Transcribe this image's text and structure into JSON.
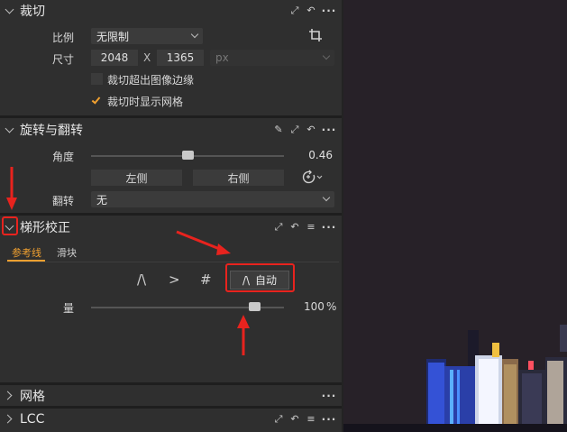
{
  "crop": {
    "title": "裁切",
    "ratio_label": "比例",
    "ratio_value": "无限制",
    "size_label": "尺寸",
    "width": "2048",
    "x_sep": "X",
    "height": "1365",
    "unit": "px",
    "check1_label": "裁切超出图像边缘",
    "check1_checked": false,
    "check2_label": "裁切时显示网格",
    "check2_checked": true
  },
  "rotate": {
    "title": "旋转与翻转",
    "angle_label": "角度",
    "angle_value": "0.46",
    "left_button": "左侧",
    "right_button": "右侧",
    "flip_label": "翻转",
    "flip_value": "无"
  },
  "keystone": {
    "title": "梯形校正",
    "tab_guides": "参考线",
    "tab_sliders": "滑块",
    "auto_label": "自动",
    "auto_icon": "/\\",
    "icon_vertical": "/\\",
    "icon_horizontal": ">",
    "icon_full": "#",
    "amount_label": "量",
    "amount_value": "100",
    "amount_unit": "%",
    "amount_level": 0.85
  },
  "grid": {
    "title": "网格"
  },
  "lcc": {
    "title": "LCC"
  },
  "colors": {
    "accent": "#f0a030",
    "annotation": "#e8231e",
    "panel_bg": "#2f2f2f"
  }
}
